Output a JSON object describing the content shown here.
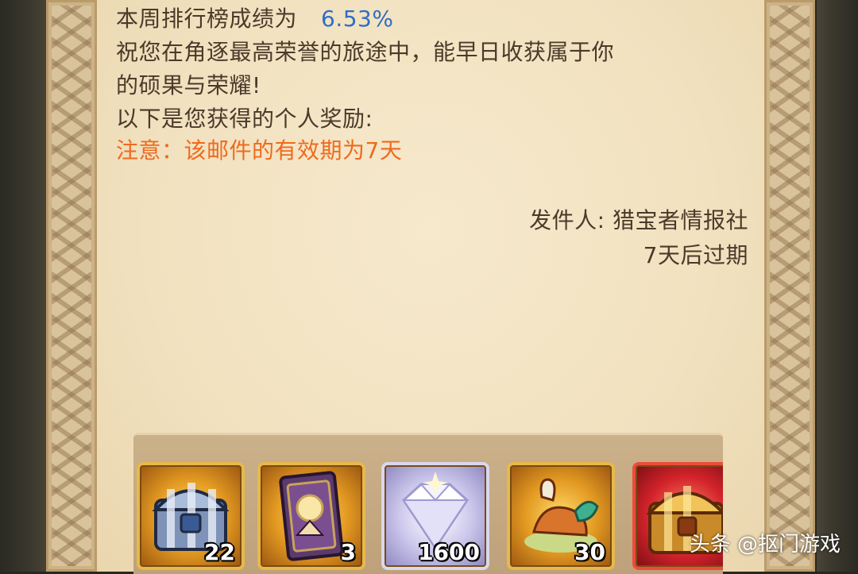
{
  "mail": {
    "line1_label": "本周排行榜成绩为",
    "line1_value": "6.53%",
    "line2": "祝您在角逐最高荣誉的旅途中，能早日收获属于你",
    "line3": "的硕果与荣耀!",
    "line4": "以下是您获得的个人奖励:",
    "notice": "注意：该邮件的有效期为7天",
    "sender": "发件人: 猎宝者情报社",
    "expiry": "7天后过期"
  },
  "rewards": [
    {
      "icon": "silver-chest-icon",
      "count": "22"
    },
    {
      "icon": "card-icon",
      "count": "3"
    },
    {
      "icon": "diamond-icon",
      "count": "1600"
    },
    {
      "icon": "food-icon",
      "count": "30"
    },
    {
      "icon": "golden-chest-icon",
      "count": ""
    }
  ],
  "watermark": "头条 @抠门游戏",
  "colors": {
    "percent": "#2f6dc6",
    "notice": "#ef6a1e",
    "body_text": "#4a3a2a",
    "parchment": "#f1e1bf"
  }
}
